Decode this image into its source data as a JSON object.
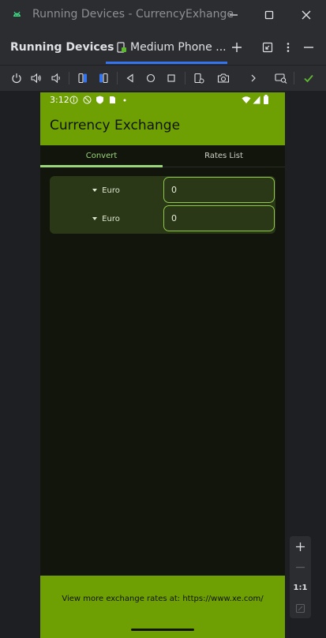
{
  "window": {
    "title": "Running Devices - CurrencyExhange",
    "icons": {
      "app": "android-icon",
      "minimize": "minimize-icon",
      "maximize": "maximize-icon",
      "close": "close-icon"
    }
  },
  "panel": {
    "title": "Running Devices",
    "tab_label": "Medium Phone ...",
    "tab_icon": "device-icon"
  },
  "toolbar": {
    "icons": [
      "power-icon",
      "volume-up-icon",
      "volume-down-icon",
      "rotate-left-icon",
      "rotate-right-icon",
      "back-icon",
      "home-icon",
      "overview-icon",
      "screen-record-icon",
      "camera-icon",
      "more-icon",
      "device-mirror-icon",
      "check-icon"
    ]
  },
  "device": {
    "status": {
      "time": "3:12"
    },
    "app_title": "Currency Exchange",
    "tabs": [
      {
        "label": "Convert",
        "selected": true
      },
      {
        "label": "Rates List",
        "selected": false
      }
    ],
    "converter": {
      "rows": [
        {
          "currency": "Euro",
          "amount": "0"
        },
        {
          "currency": "Euro",
          "amount": "0"
        }
      ]
    },
    "footer_text": "View more exchange rates at: https://www.xe.com/"
  },
  "zoom": {
    "reset_label": "1:1"
  },
  "colors": {
    "accent": "#6ea004",
    "tab_indicator": "#9cd67a",
    "field_border": "#8ec84a",
    "ide_accent": "#3574f0",
    "check": "#5fb832"
  }
}
